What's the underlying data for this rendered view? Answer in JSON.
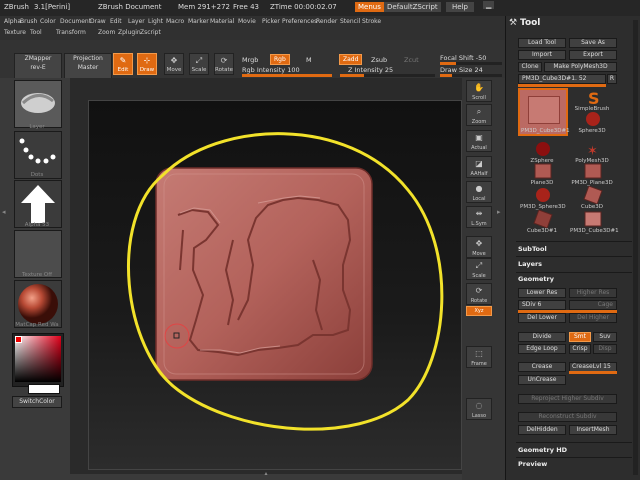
{
  "title_bar": {
    "app": "ZBrush",
    "version": "3.1[Perini]",
    "document": "ZBrush Document",
    "mem": "Mem 291+272",
    "free": "Free 43",
    "ztime": "ZTime 00:00:02.07",
    "menus_btn": "Menus",
    "script": "DefaultZScript",
    "help": "Help"
  },
  "menu_row1": [
    "Alpha",
    "Brush",
    "Color",
    "Document",
    "Draw",
    "Edit",
    "Layer",
    "Light",
    "Macro",
    "Marker",
    "Material",
    "Movie",
    "Picker",
    "Preferences",
    "Render",
    "Stencil",
    "Stroke"
  ],
  "menu_row2": [
    "Texture",
    "Tool",
    "Transform",
    "Zoom",
    "Zplugin",
    "Zscript"
  ],
  "toolbar": {
    "zmapper": "ZMapper",
    "zmapper_sub": "rev-E",
    "projection": "Projection",
    "projection_sub": "Master",
    "edit": "Edit",
    "draw": "Draw",
    "move": "Move",
    "scale": "Scale",
    "rotate": "Rotate",
    "mrgb": "Mrgb",
    "rgb": "Rgb",
    "m": "M",
    "rgb_intensity": "Rgb Intensity 100",
    "zadd": "Zadd",
    "zsub": "Zsub",
    "zcut": "Zcut",
    "z_intensity": "Z Intensity 25",
    "focal_shift": "Focal Shift -50",
    "draw_size": "Draw Size 24",
    "z_intensity_value": 25,
    "focal_shift_value": -50,
    "draw_size_value": 24
  },
  "left_shelf": {
    "labels": [
      "Layer",
      "Dots",
      "Alpha 53",
      "Texture Off",
      "MatCap Red Wa"
    ],
    "switch_color": "SwitchColor"
  },
  "right_shelf": [
    {
      "name": "scroll",
      "label": "Scroll"
    },
    {
      "name": "zoom",
      "label": "Zoom"
    },
    {
      "name": "actual",
      "label": "Actual"
    },
    {
      "name": "aahalf",
      "label": "AAHalf"
    },
    {
      "name": "local",
      "label": "Local"
    },
    {
      "name": "lsym",
      "label": "L.Sym"
    },
    {
      "name": "move",
      "label": "Move"
    },
    {
      "name": "scale",
      "label": "Scale"
    },
    {
      "name": "rotate",
      "label": "Rotate"
    },
    {
      "name": "xyz",
      "label": "Xyz"
    },
    {
      "name": "frame",
      "label": "Frame"
    },
    {
      "name": "lasso",
      "label": "Lasso"
    }
  ],
  "tool_panel": {
    "title": "Tool",
    "load_tool": "Load Tool",
    "save_as": "Save As",
    "import": "Import",
    "export": "Export",
    "clone": "Clone",
    "make_polymesh": "Make PolyMesh3D",
    "current_tool": "PM3D_Cube3D#1. 52",
    "r": "R",
    "tools": [
      "PM3D_Cube3D#1",
      "SimpleBrush",
      "Sphere3D",
      "ZSphere",
      "PolyMesh3D",
      "Plane3D",
      "PM3D_Plane3D",
      "PM3D_Sphere3D",
      "Cube3D",
      "Cube3D#1",
      "PM3D_Cube3D#1"
    ],
    "subtool": "SubTool",
    "layers": "Layers",
    "geometry": "Geometry",
    "lower_res": "Lower Res",
    "higher_res": "Higher Res",
    "sdiv": "SDiv 6",
    "cage": "Cage",
    "del_lower": "Del Lower",
    "del_higher": "Del Higher",
    "divide": "Divide",
    "smt": "Smt",
    "suv": "Suv",
    "edge_loop": "Edge Loop",
    "crisp": "Crisp",
    "disp": "Disp",
    "crease": "Crease",
    "crease_lvl": "CreaseLvl 15",
    "uncrease": "UnCrease",
    "reproject": "Reproject Higher Subdiv",
    "reconstruct": "Reconstruct Subdiv",
    "delhidden": "DelHidden",
    "insertmesh": "InsertMesh",
    "geometry_hd": "Geometry HD",
    "preview": "Preview"
  },
  "colors": {
    "accent": "#e06a12",
    "clay": "#b8645e",
    "selection_stroke": "#f2e22a"
  }
}
